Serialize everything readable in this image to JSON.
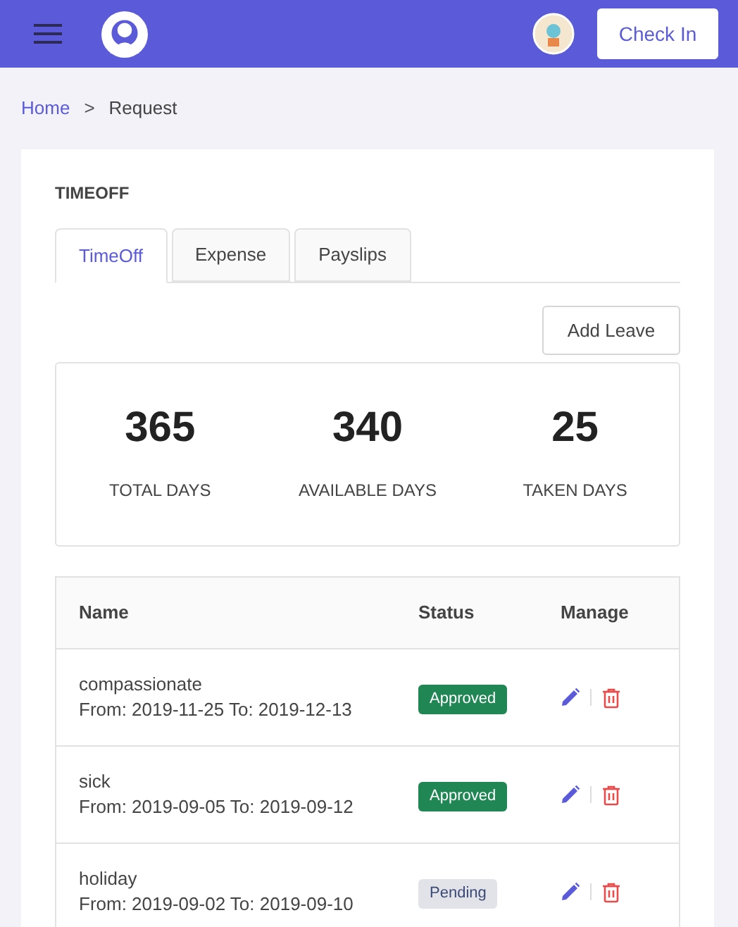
{
  "header": {
    "check_in": "Check In"
  },
  "breadcrumb": {
    "home": "Home",
    "separator": ">",
    "current": "Request"
  },
  "section_title": "TIMEOFF",
  "tabs": [
    {
      "label": "TimeOff",
      "selected": true
    },
    {
      "label": "Expense",
      "selected": false
    },
    {
      "label": "Payslips",
      "selected": false
    }
  ],
  "add_button": "Add Leave",
  "stats": [
    {
      "value": "365",
      "label": "TOTAL DAYS"
    },
    {
      "value": "340",
      "label": "AVAILABLE DAYS"
    },
    {
      "value": "25",
      "label": "TAKEN DAYS"
    }
  ],
  "table": {
    "columns": [
      "Name",
      "Status",
      "Manage"
    ],
    "rows": [
      {
        "name": "compassionate",
        "dates": "From: 2019-11-25 To: 2019-12-13",
        "status": {
          "kind": "approved",
          "label": "Approved"
        }
      },
      {
        "name": "sick",
        "dates": "From: 2019-09-05 To: 2019-09-12",
        "status": {
          "kind": "approved",
          "label": "Approved"
        }
      },
      {
        "name": "holiday",
        "dates": "From: 2019-09-02 To: 2019-09-10",
        "status": {
          "kind": "pending",
          "label": "Pending"
        }
      }
    ]
  }
}
